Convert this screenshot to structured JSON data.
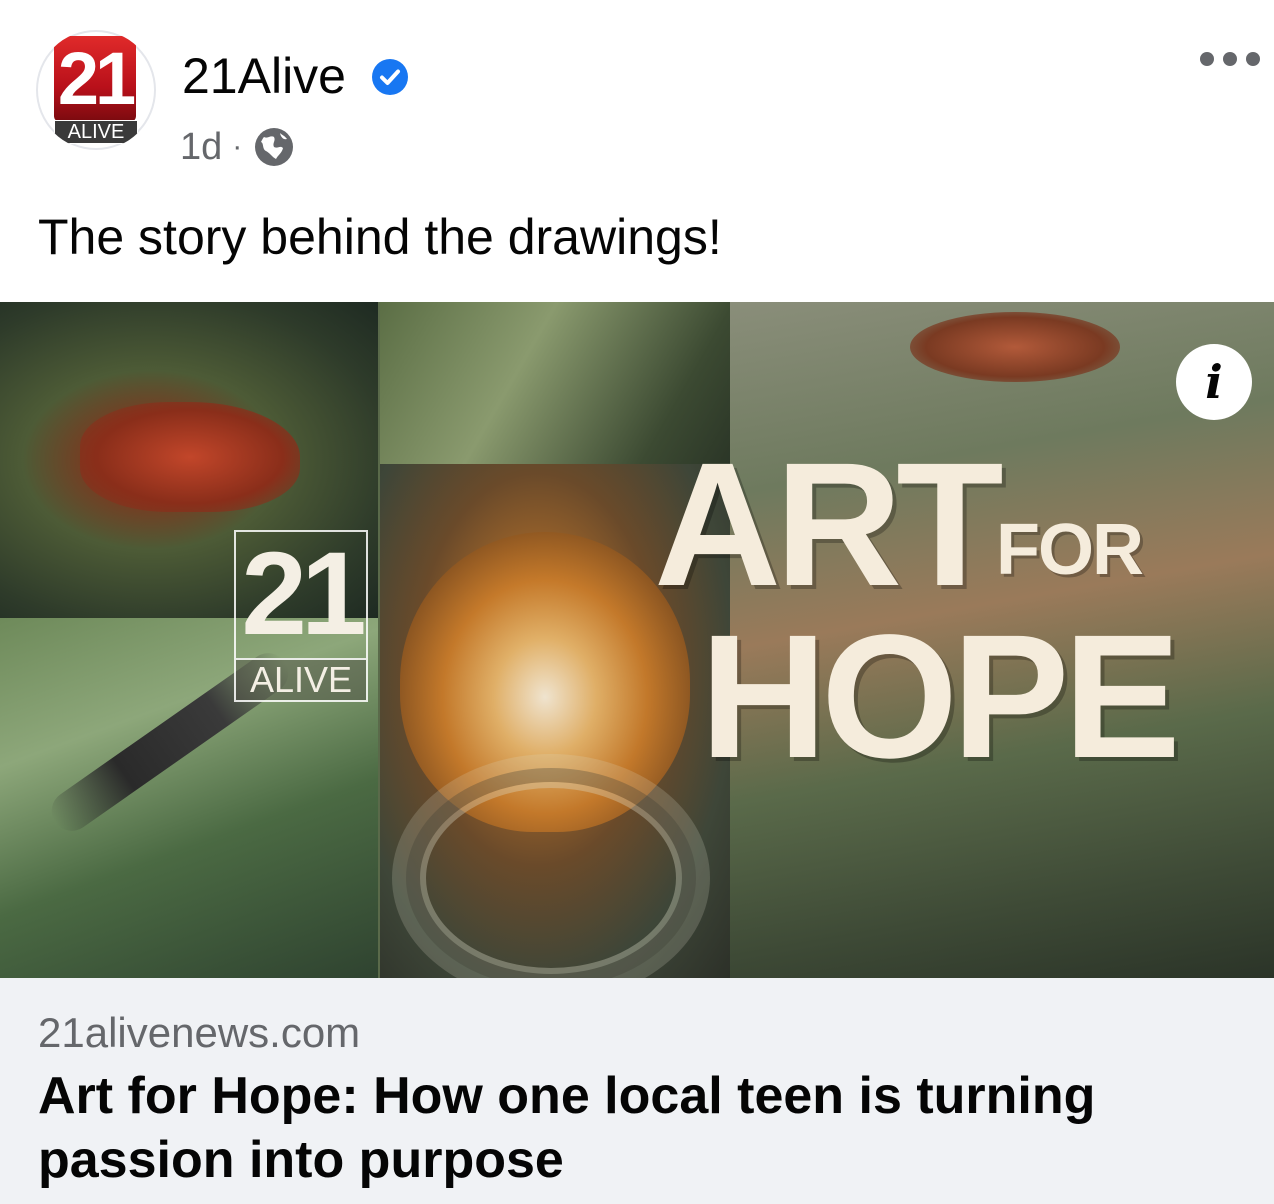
{
  "post": {
    "page_name": "21Alive",
    "time": "1d",
    "separator": "·",
    "caption": "The story behind the drawings!",
    "avatar": {
      "logo_number": "21",
      "logo_text": "ALIVE"
    }
  },
  "media": {
    "watermark_number": "21",
    "watermark_text": "ALIVE",
    "headline_art": "ART",
    "headline_for": "FOR",
    "headline_hope": "HOPE",
    "info_glyph": "i"
  },
  "link_preview": {
    "domain": "21alivenews.com",
    "title": "Art for Hope: How one local teen is turning passion into purpose"
  },
  "icons": [
    "verified-badge-icon",
    "globe-icon",
    "more-options-icon",
    "info-icon"
  ],
  "colors": {
    "verified": "#1877f2",
    "secondary_text": "#65676b",
    "link_box_bg": "#f0f2f5"
  }
}
